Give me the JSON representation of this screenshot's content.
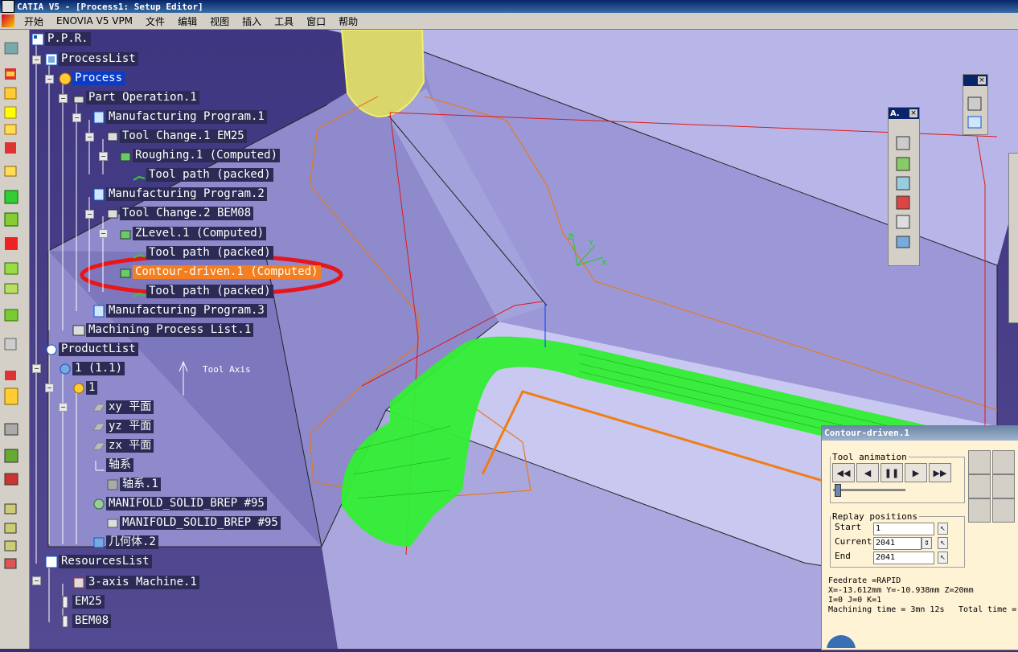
{
  "window": {
    "title": "CATIA V5 - [Process1: Setup Editor]"
  },
  "menu": [
    "开始",
    "ENOVIA V5 VPM",
    "文件",
    "编辑",
    "视图",
    "插入",
    "工具",
    "窗口",
    "帮助"
  ],
  "tree": {
    "root": "P.P.R.",
    "process_list": "ProcessList",
    "process": "Process",
    "part_operation": "Part Operation.1",
    "mp1": "Manufacturing Program.1",
    "tc1": "Tool Change.1  EM25",
    "roughing": "Roughing.1 (Computed)",
    "toolpath1": "Tool path (packed)",
    "mp2": "Manufacturing Program.2",
    "tc2": "Tool Change.2  BEM08",
    "zlevel": "ZLevel.1 (Computed)",
    "toolpath2": "Tool path (packed)",
    "contour": "Contour-driven.1 (Computed)",
    "toolpath3": "Tool path (packed)",
    "mp3": "Manufacturing Program.3",
    "mpl": "Machining Process List.1",
    "product_list": "ProductList",
    "prod1": "1 (1.1)",
    "prod1_child": "1",
    "xy": "xy 平面",
    "yz": "yz 平面",
    "zx": "zx 平面",
    "axis_sys": "轴系",
    "axis_sys1": "轴系.1",
    "manifold": "MANIFOLD_SOLID_BREP #95",
    "manifold_child": "MANIFOLD_SOLID_BREP #95",
    "geometry": "几何体.2",
    "resources_list": "ResourcesList",
    "machine": "3-axis Machine.1",
    "em25": "EM25",
    "bem08": "BEM08"
  },
  "viewport": {
    "tool_axis_label": "Tool Axis"
  },
  "toolbars": {
    "float1_title": "A.",
    "float2_title": ""
  },
  "panel": {
    "title": "Contour-driven.1",
    "tool_animation": "Tool animation",
    "replay_positions": "Replay positions",
    "start_label": "Start",
    "start_value": "1",
    "current_label": "Current",
    "current_value": "2041",
    "end_label": "End",
    "end_value": "2041",
    "slider_position": 0.02,
    "feedrate": "Feedrate =RAPID",
    "coords": "X=-13.612mm Y=-10.938mm Z=20mm",
    "ijk": "I=0 J=0 K=1",
    "machining_time": "Machining time = 3mn 12s",
    "total_time": "Total time ="
  },
  "colors": {
    "highlight": "#f57f1e",
    "selection": "#0a3cc8",
    "toolpath": "#33ee33",
    "annotation_ring": "#e8161b"
  }
}
